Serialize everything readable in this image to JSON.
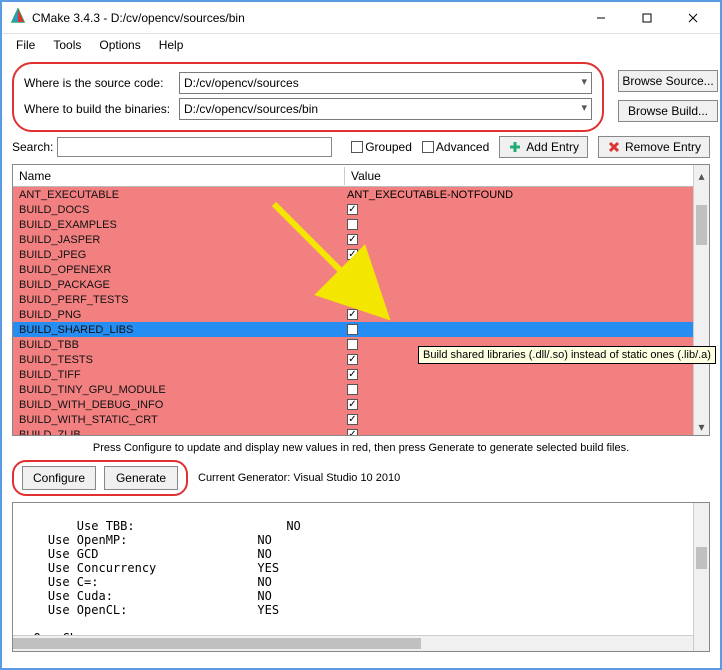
{
  "window": {
    "title": "CMake 3.4.3 - D:/cv/opencv/sources/bin",
    "min_icon": "minimize-icon",
    "max_icon": "maximize-icon",
    "close_icon": "close-icon"
  },
  "menu": {
    "file": "File",
    "tools": "Tools",
    "options": "Options",
    "help": "Help"
  },
  "paths": {
    "source_label": "Where is the source code:",
    "source_value": "D:/cv/opencv/sources",
    "build_label": "Where to build the binaries:",
    "build_value": "D:/cv/opencv/sources/bin",
    "browse_source": "Browse Source...",
    "browse_build": "Browse Build..."
  },
  "search": {
    "label": "Search:",
    "value": "",
    "grouped_label": "Grouped",
    "advanced_label": "Advanced",
    "add_entry": "Add Entry",
    "remove_entry": "Remove Entry"
  },
  "table": {
    "name_header": "Name",
    "value_header": "Value",
    "rows": [
      {
        "name": "ANT_EXECUTABLE",
        "value_text": "ANT_EXECUTABLE-NOTFOUND",
        "type": "text",
        "sel": false
      },
      {
        "name": "BUILD_DOCS",
        "type": "check",
        "checked": true,
        "sel": false
      },
      {
        "name": "BUILD_EXAMPLES",
        "type": "check",
        "checked": false,
        "sel": false
      },
      {
        "name": "BUILD_JASPER",
        "type": "check",
        "checked": true,
        "sel": false
      },
      {
        "name": "BUILD_JPEG",
        "type": "check",
        "checked": true,
        "sel": false
      },
      {
        "name": "BUILD_OPENEXR",
        "type": "check",
        "checked": true,
        "sel": false
      },
      {
        "name": "BUILD_PACKAGE",
        "type": "check",
        "checked": true,
        "sel": false
      },
      {
        "name": "BUILD_PERF_TESTS",
        "type": "check",
        "checked": true,
        "sel": false
      },
      {
        "name": "BUILD_PNG",
        "type": "check",
        "checked": true,
        "sel": false
      },
      {
        "name": "BUILD_SHARED_LIBS",
        "type": "check",
        "checked": false,
        "sel": true
      },
      {
        "name": "BUILD_TBB",
        "type": "check",
        "checked": false,
        "sel": false
      },
      {
        "name": "BUILD_TESTS",
        "type": "check",
        "checked": true,
        "sel": false
      },
      {
        "name": "BUILD_TIFF",
        "type": "check",
        "checked": true,
        "sel": false
      },
      {
        "name": "BUILD_TINY_GPU_MODULE",
        "type": "check",
        "checked": false,
        "sel": false
      },
      {
        "name": "BUILD_WITH_DEBUG_INFO",
        "type": "check",
        "checked": true,
        "sel": false
      },
      {
        "name": "BUILD_WITH_STATIC_CRT",
        "type": "check",
        "checked": true,
        "sel": false
      },
      {
        "name": "BUILD_ZLIB",
        "type": "check",
        "checked": true,
        "sel": false
      }
    ]
  },
  "tooltip": "Build shared libraries (.dll/.so) instead of static ones (.lib/.a)",
  "hint": "Press Configure to update and display new values in red, then press Generate to generate selected build files.",
  "buttons": {
    "configure": "Configure",
    "generate": "Generate"
  },
  "generator_label": "Current Generator: Visual Studio 10 2010",
  "output_text": "    Use TBB:                     NO\n    Use OpenMP:                  NO\n    Use GCD                      NO\n    Use Concurrency              YES\n    Use C=:                      NO\n    Use Cuda:                    NO\n    Use OpenCL:                  YES\n\n  OpenCL:\n    Version:                     dynamic"
}
